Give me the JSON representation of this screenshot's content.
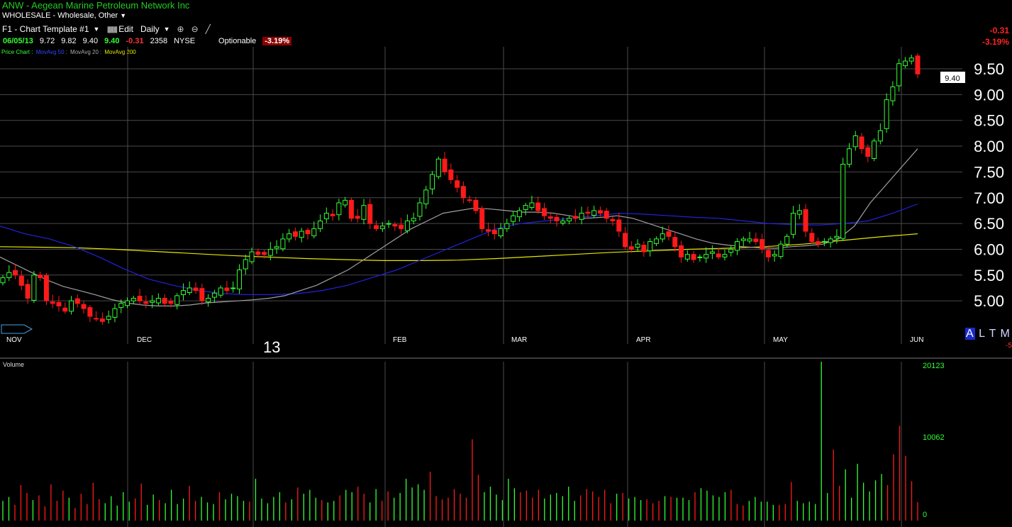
{
  "header": {
    "title": "ANW - Aegean Marine Petroleum Network Inc",
    "industry": "WHOLESALE - Wholesale, Other"
  },
  "toolbar": {
    "template": "F1 - Chart Template #1",
    "edit": "Edit",
    "period": "Daily"
  },
  "quote": {
    "date": "06/05/13",
    "open": "9.72",
    "high": "9.82",
    "low": "9.40",
    "last": "9.40",
    "change": "-0.31",
    "volume": "2358",
    "exchange": "NYSE",
    "optionable": "Optionable",
    "change_pct": "-3.19%"
  },
  "legend": {
    "price": "Price Chart :",
    "ma50": "MovAvg 50",
    "ma20": "MovAvg 20",
    "ma200": "MovAvg 200",
    "sep": ":"
  },
  "right_summary": {
    "change": "-0.31",
    "change_pct": "-3.19%"
  },
  "last_price_tag": "9.40",
  "year_label": "13",
  "altml": {
    "a": "A",
    "rest": "L T M L"
  },
  "cut_text": "-5",
  "volume_label": "Volume",
  "colors": {
    "up": "#33ff33",
    "down": "#ff1a1a",
    "ma50": "#2222dd",
    "ma20": "#a0a0a0",
    "ma200": "#e6e600",
    "grid": "#4a4a4a"
  },
  "chart_data": {
    "type": "candlestick",
    "price_axis": {
      "ticks": [
        "9.50",
        "9.00",
        "8.50",
        "8.00",
        "7.50",
        "7.00",
        "6.50",
        "6.00",
        "5.50",
        "5.00"
      ],
      "range": [
        4.45,
        9.95
      ]
    },
    "months": [
      "NOV",
      "DEC",
      "FEB",
      "MAR",
      "APR",
      "MAY",
      "JUN"
    ],
    "volume_axis": {
      "ticks": [
        "20123",
        "10062",
        "0"
      ],
      "max": 20123
    },
    "close_series": [
      5.45,
      5.55,
      5.5,
      5.3,
      5.05,
      5.5,
      5.45,
      5.0,
      4.95,
      4.9,
      4.8,
      5.0,
      4.95,
      4.85,
      4.7,
      4.65,
      4.6,
      4.7,
      4.85,
      4.95,
      5.0,
      5.05,
      5.0,
      4.95,
      5.0,
      5.05,
      4.95,
      4.95,
      5.1,
      5.2,
      5.25,
      5.2,
      5.0,
      5.05,
      5.15,
      5.25,
      5.2,
      5.25,
      5.6,
      5.8,
      5.95,
      5.9,
      5.9,
      6.0,
      6.05,
      6.2,
      6.3,
      6.25,
      6.35,
      6.3,
      6.4,
      6.55,
      6.7,
      6.65,
      6.9,
      6.95,
      6.6,
      6.6,
      6.85,
      6.5,
      6.4,
      6.45,
      6.5,
      6.45,
      6.4,
      6.55,
      6.6,
      6.9,
      7.15,
      7.45,
      7.75,
      7.5,
      7.35,
      7.2,
      7.0,
      6.95,
      6.75,
      6.4,
      6.35,
      6.3,
      6.4,
      6.5,
      6.65,
      6.75,
      6.85,
      6.9,
      6.75,
      6.65,
      6.6,
      6.55,
      6.55,
      6.6,
      6.6,
      6.7,
      6.7,
      6.75,
      6.7,
      6.6,
      6.55,
      6.35,
      6.05,
      6.0,
      6.1,
      5.95,
      6.15,
      6.2,
      6.3,
      6.25,
      6.05,
      5.85,
      5.9,
      5.8,
      5.85,
      5.9,
      5.95,
      5.85,
      5.9,
      6.0,
      6.15,
      6.2,
      6.2,
      6.15,
      6.0,
      5.85,
      5.9,
      6.1,
      6.25,
      6.7,
      6.75,
      6.35,
      6.15,
      6.1,
      6.15,
      6.2,
      6.25,
      7.65,
      7.95,
      8.2,
      7.95,
      7.8,
      8.1,
      8.3,
      8.9,
      9.15,
      9.6,
      9.65,
      9.71,
      9.4
    ],
    "ma20_series": [
      5.85,
      5.7,
      5.55,
      5.4,
      5.28,
      5.2,
      5.12,
      5.03,
      4.96,
      4.92,
      4.9,
      4.9,
      4.92,
      4.96,
      4.98,
      5.0,
      5.02,
      5.05,
      5.1,
      5.2,
      5.3,
      5.45,
      5.6,
      5.8,
      6.0,
      6.2,
      6.4,
      6.55,
      6.7,
      6.75,
      6.8,
      6.78,
      6.75,
      6.72,
      6.72,
      6.7,
      6.65,
      6.6,
      6.62,
      6.65,
      6.6,
      6.5,
      6.4,
      6.3,
      6.2,
      6.12,
      6.08,
      6.05,
      6.03,
      6.02,
      6.05,
      6.07,
      6.1,
      6.2,
      6.45,
      6.9,
      7.25,
      7.6,
      7.95
    ],
    "ma50_series": [
      6.45,
      6.3,
      6.2,
      6.05,
      5.85,
      5.62,
      5.42,
      5.3,
      5.2,
      5.14,
      5.12,
      5.12,
      5.14,
      5.2,
      5.3,
      5.45,
      5.6,
      5.8,
      6.0,
      6.2,
      6.4,
      6.5,
      6.55,
      6.6,
      6.65,
      6.7,
      6.68,
      6.65,
      6.62,
      6.6,
      6.55,
      6.5,
      6.48,
      6.47,
      6.5,
      6.55,
      6.7,
      6.88
    ],
    "ma200_series": [
      6.05,
      6.04,
      6.03,
      6.0,
      5.96,
      5.92,
      5.88,
      5.85,
      5.82,
      5.8,
      5.78,
      5.78,
      5.79,
      5.82,
      5.86,
      5.9,
      5.94,
      5.97,
      6.0,
      6.02,
      6.05,
      6.1,
      6.17,
      6.24,
      6.3
    ],
    "volume_series": [
      2500,
      3000,
      2000,
      4500,
      3500,
      2600,
      3200,
      1800,
      4600,
      2500,
      3800,
      2900,
      1600,
      3400,
      2100,
      4800,
      2700,
      2200,
      3100,
      1900,
      3600,
      2400,
      2800,
      4700,
      2000,
      3300,
      2600,
      2200,
      3900,
      2100,
      2800,
      4400,
      2500,
      3000,
      2300,
      2100,
      3600,
      2700,
      3400,
      3100,
      2500,
      2400,
      5300,
      2800,
      2200,
      3000,
      3600,
      2300,
      2700,
      4200,
      3400,
      3900,
      2900,
      2600,
      2300,
      2500,
      3200,
      3900,
      3600,
      4300,
      3400,
      2300,
      4000,
      2500,
      3700,
      2900,
      3500,
      5300,
      4200,
      4600,
      3900,
      6200,
      3100,
      2700,
      2900,
      4000,
      3400,
      2900,
      10300,
      5800,
      3600,
      4300,
      3300,
      2600,
      5300,
      4100,
      3600,
      3800,
      2900,
      3900,
      2800,
      3300,
      3500,
      3100,
      4300,
      2500,
      3200,
      4000,
      3700,
      3000,
      3900,
      2200,
      3400,
      3500,
      2800,
      3000,
      2600,
      2700,
      2200,
      2500,
      3100,
      3000,
      2900,
      2900,
      2600,
      3600,
      4100,
      3800,
      3200,
      3000,
      3600,
      3900,
      2100,
      1900,
      2500,
      3000,
      2400,
      2400,
      2000,
      2000,
      2100,
      4900,
      2500,
      2200,
      2400,
      2100,
      20123,
      3500,
      9000,
      4400,
      6500,
      2900,
      7200,
      4800,
      3700,
      5100,
      5900,
      4500,
      8400,
      12000,
      8200,
      5000,
      2358
    ],
    "summary": {
      "last": 9.4,
      "change": -0.31,
      "change_pct": -3.19
    }
  }
}
